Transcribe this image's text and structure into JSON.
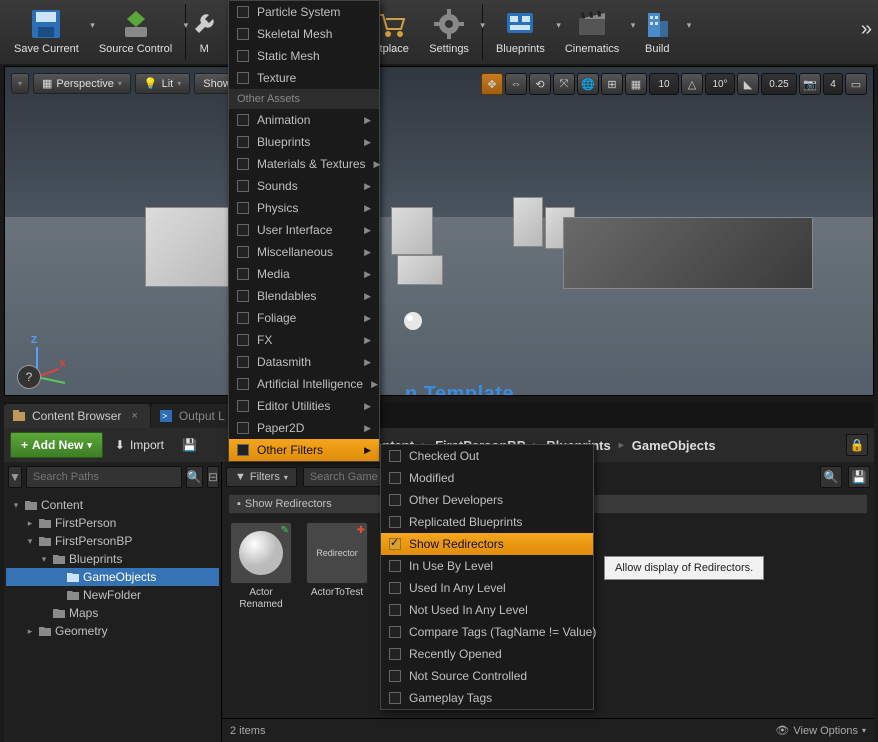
{
  "toolbar": {
    "save": "Save Current",
    "source_control": "Source Control",
    "modes": "M",
    "marketplace": "etplace",
    "settings": "Settings",
    "blueprints": "Blueprints",
    "cinematics": "Cinematics",
    "build": "Build"
  },
  "viewport": {
    "menu_dd": "▾",
    "perspective": "Perspective",
    "lit": "Lit",
    "show": "Show",
    "snap_pos": "10",
    "snap_rot": "10°",
    "snap_scale": "0.25",
    "cam_speed": "4",
    "template_text": "n Template"
  },
  "tabs": {
    "content_browser": "Content Browser",
    "output_log": "Output L"
  },
  "cb": {
    "add_new": "Add New",
    "import": "Import",
    "search_paths_ph": "Search Paths",
    "search_assets_ph": "Search Game",
    "filters": "Filters",
    "chip": "Show Redirectors",
    "items_count": "2 items",
    "view_options": "View Options",
    "breadcrumb": [
      "Content",
      "FirstPersonBP",
      "Blueprints",
      "GameObjects"
    ]
  },
  "tree": [
    {
      "label": "Content",
      "depth": 0,
      "open": true,
      "sel": false
    },
    {
      "label": "FirstPerson",
      "depth": 1,
      "open": false,
      "sel": false,
      "tw": "▸"
    },
    {
      "label": "FirstPersonBP",
      "depth": 1,
      "open": true,
      "sel": false,
      "tw": "▾"
    },
    {
      "label": "Blueprints",
      "depth": 2,
      "open": true,
      "sel": false,
      "tw": "▾"
    },
    {
      "label": "GameObjects",
      "depth": 3,
      "open": false,
      "sel": true
    },
    {
      "label": "NewFolder",
      "depth": 3,
      "open": false,
      "sel": false
    },
    {
      "label": "Maps",
      "depth": 2,
      "open": false,
      "sel": false
    },
    {
      "label": "Geometry",
      "depth": 1,
      "open": false,
      "sel": false,
      "tw": "▸"
    }
  ],
  "assets": [
    {
      "name": "Actor\nRenamed",
      "kind": "sphere",
      "corner": "✎",
      "cclr": "#3bcf5a"
    },
    {
      "name": "ActorToTest",
      "kind": "text",
      "text": "Redirector",
      "corner": "✚",
      "cclr": "#e05030"
    }
  ],
  "menu1": {
    "items_top": [
      "Particle System",
      "Skeletal Mesh",
      "Static Mesh",
      "Texture"
    ],
    "header": "Other Assets",
    "items_sub": [
      "Animation",
      "Blueprints",
      "Materials & Textures",
      "Sounds",
      "Physics",
      "User Interface",
      "Miscellaneous",
      "Media",
      "Blendables",
      "Foliage",
      "FX",
      "Datasmith",
      "Artificial Intelligence",
      "Editor Utilities",
      "Paper2D"
    ],
    "highlight": "Other Filters"
  },
  "menu2": {
    "items": [
      {
        "label": "Checked Out",
        "on": false
      },
      {
        "label": "Modified",
        "on": false
      },
      {
        "label": "Other Developers",
        "on": false
      },
      {
        "label": "Replicated Blueprints",
        "on": false
      },
      {
        "label": "Show Redirectors",
        "on": true,
        "hi": true
      },
      {
        "label": "In Use By Level",
        "on": false
      },
      {
        "label": "Used In Any Level",
        "on": false
      },
      {
        "label": "Not Used In Any Level",
        "on": false
      },
      {
        "label": "Compare Tags (TagName != Value)",
        "on": false
      },
      {
        "label": "Recently Opened",
        "on": false
      },
      {
        "label": "Not Source Controlled",
        "on": false
      },
      {
        "label": "Gameplay Tags",
        "on": false
      }
    ]
  },
  "tooltip": "Allow display of Redirectors."
}
